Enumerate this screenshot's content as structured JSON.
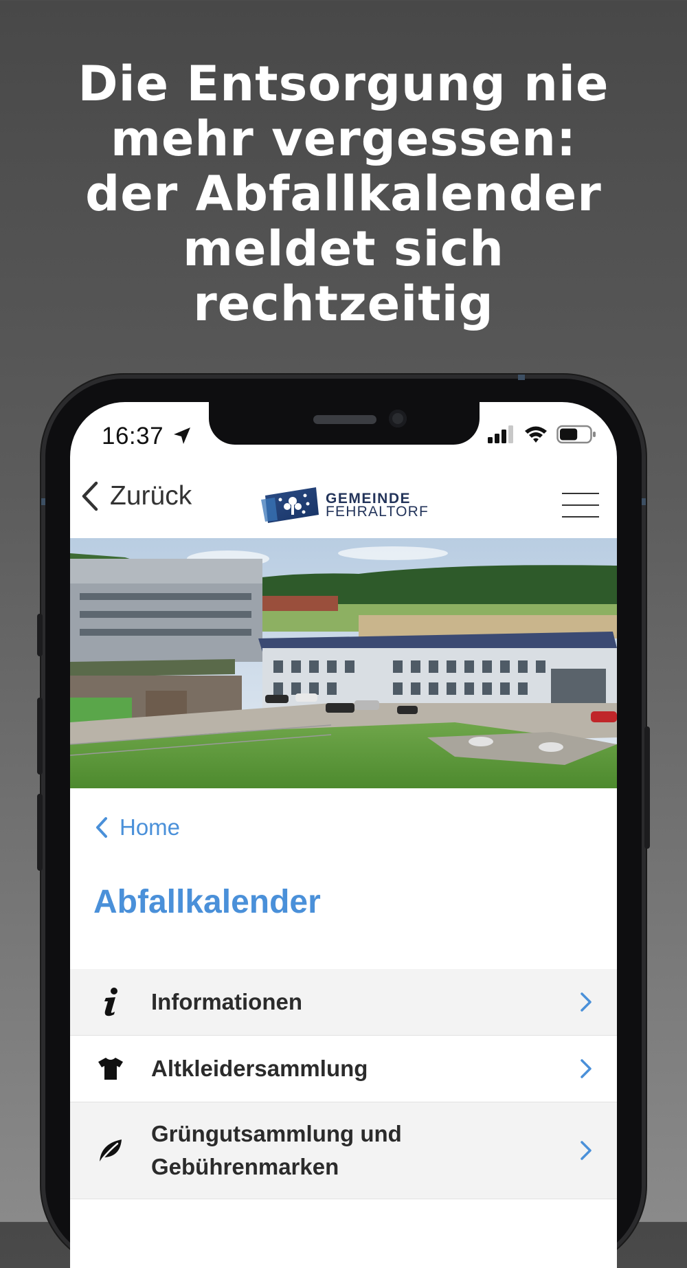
{
  "headline": "Die Entsorgung nie\nmehr vergessen:\nder Abfallkalender\nmeldet sich\nrechtzeitig",
  "status_bar": {
    "time": "16:37",
    "battery_level": 0.6
  },
  "nav": {
    "back_label": "Zurück",
    "logo_line1": "GEMEINDE",
    "logo_line2": "FEHRALTORF"
  },
  "breadcrumb": {
    "label": "Home"
  },
  "page_title": "Abfallkalender",
  "menu": {
    "items": [
      {
        "label": "Informationen",
        "icon": "info-icon"
      },
      {
        "label": "Altkleidersammlung",
        "icon": "tshirt-icon"
      },
      {
        "label": "Grüngutsammlung und Gebührenmarken",
        "icon": "leaf-icon"
      }
    ]
  },
  "colors": {
    "accent": "#4a90d9",
    "brand": "#23345a",
    "text": "#2b2b2b"
  }
}
